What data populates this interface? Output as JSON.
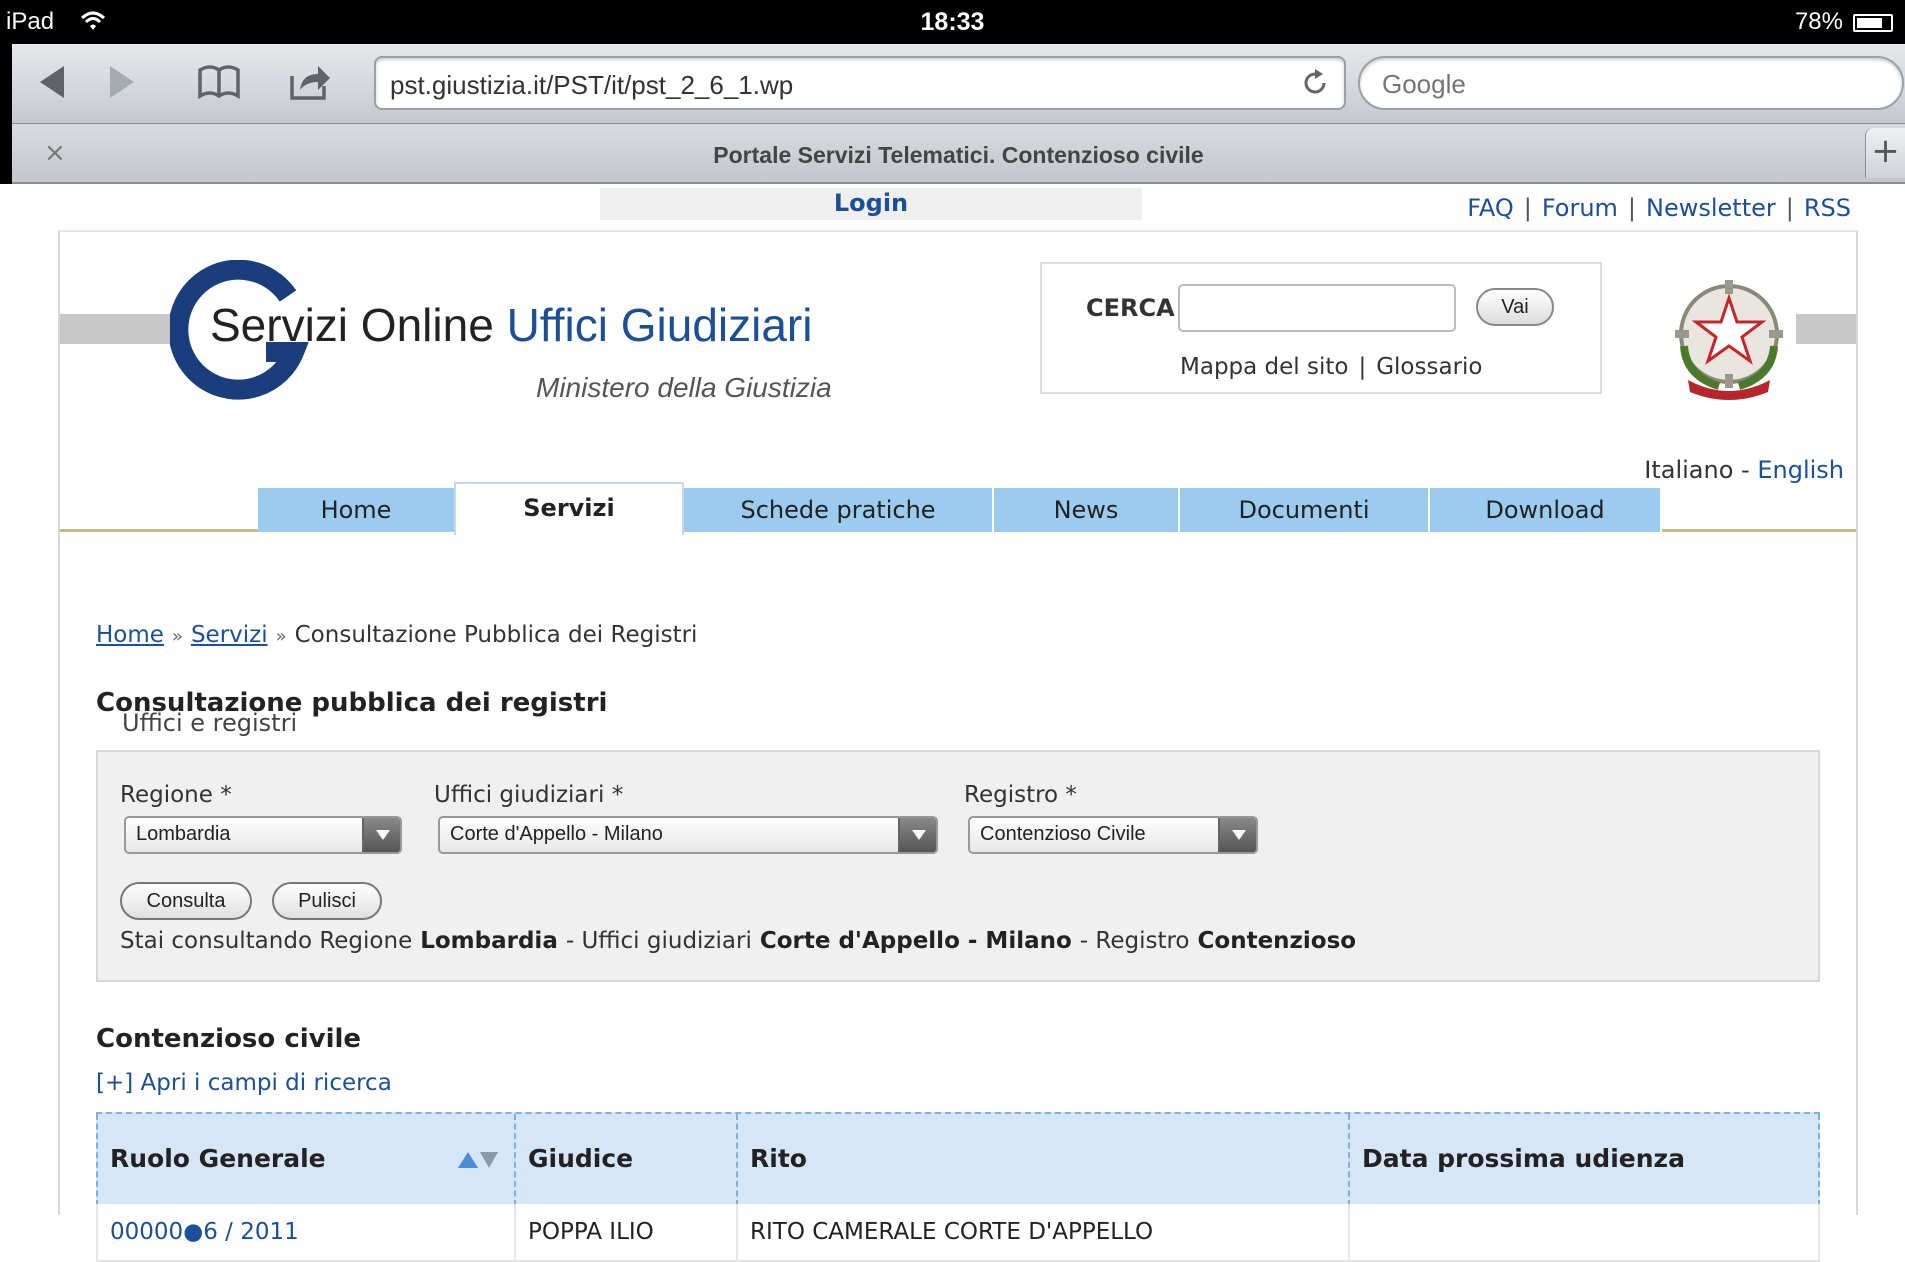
{
  "status_bar": {
    "device": "iPad",
    "time": "18:33",
    "battery": "78%",
    "battery_level": 0.78
  },
  "browser": {
    "url": "pst.giustizia.it/PST/it/pst_2_6_1.wp",
    "search_placeholder": "Google",
    "tab_title": "Portale Servizi Telematici. Contenzioso civile",
    "close_glyph": "×",
    "new_tab_glyph": "+"
  },
  "header": {
    "login": "Login",
    "links": [
      "FAQ",
      "Forum",
      "Newsletter",
      "RSS"
    ],
    "link_separator": "|",
    "logo_text_black": "Servizi Online ",
    "logo_text_blue": "Uffici Giudiziari",
    "logo_subtitle": "Ministero della Giustizia",
    "search_label": "CERCA",
    "search_button": "Vai",
    "site_links": [
      "Mappa del sito",
      "Glossario"
    ],
    "lang_current": "Italiano",
    "lang_sep": " - ",
    "lang_other": "English"
  },
  "nav": {
    "tabs": [
      {
        "label": "Home",
        "active": false
      },
      {
        "label": "Servizi",
        "active": true
      },
      {
        "label": "Schede pratiche",
        "active": false
      },
      {
        "label": "News",
        "active": false
      },
      {
        "label": "Documenti",
        "active": false
      },
      {
        "label": "Download",
        "active": false
      }
    ]
  },
  "breadcrumb": {
    "items": [
      "Home",
      "Servizi",
      "Consultazione Pubblica dei Registri"
    ],
    "separator": "»"
  },
  "main": {
    "title": "Consultazione pubblica dei registri",
    "fieldset_legend": "Uffici e registri",
    "filters": {
      "regione": {
        "label": "Regione *",
        "value": "Lombardia"
      },
      "uffici": {
        "label": "Uffici giudiziari *",
        "value": "Corte d'Appello - Milano"
      },
      "registro": {
        "label": "Registro *",
        "value": "Contenzioso Civile"
      }
    },
    "buttons": {
      "consulta": "Consulta",
      "pulisci": "Pulisci"
    },
    "summary": {
      "t1": "Stai consultando Regione",
      "v1": "Lombardia",
      "t2": "- Uffici giudiziari",
      "v2": "Corte d'Appello - Milano",
      "t3": "- Registro",
      "v3": "Contenzioso"
    },
    "section_title": "Contenzioso civile",
    "search_toggle": "[+] Apri i campi di ricerca",
    "table": {
      "headers": [
        "Ruolo Generale",
        "Giudice",
        "Rito",
        "Data prossima udienza"
      ],
      "rows": [
        {
          "ruolo": "00000●6 / 2011",
          "giudice": "POPPA ILIO",
          "rito": "RITO CAMERALE CORTE D'APPELLO",
          "data": ""
        }
      ]
    }
  },
  "colors": {
    "link_blue": "#1c4f97",
    "nav_tab": "#9ccbf0",
    "table_header": "#d5e6f8",
    "accent_line": "#c9b98a"
  }
}
